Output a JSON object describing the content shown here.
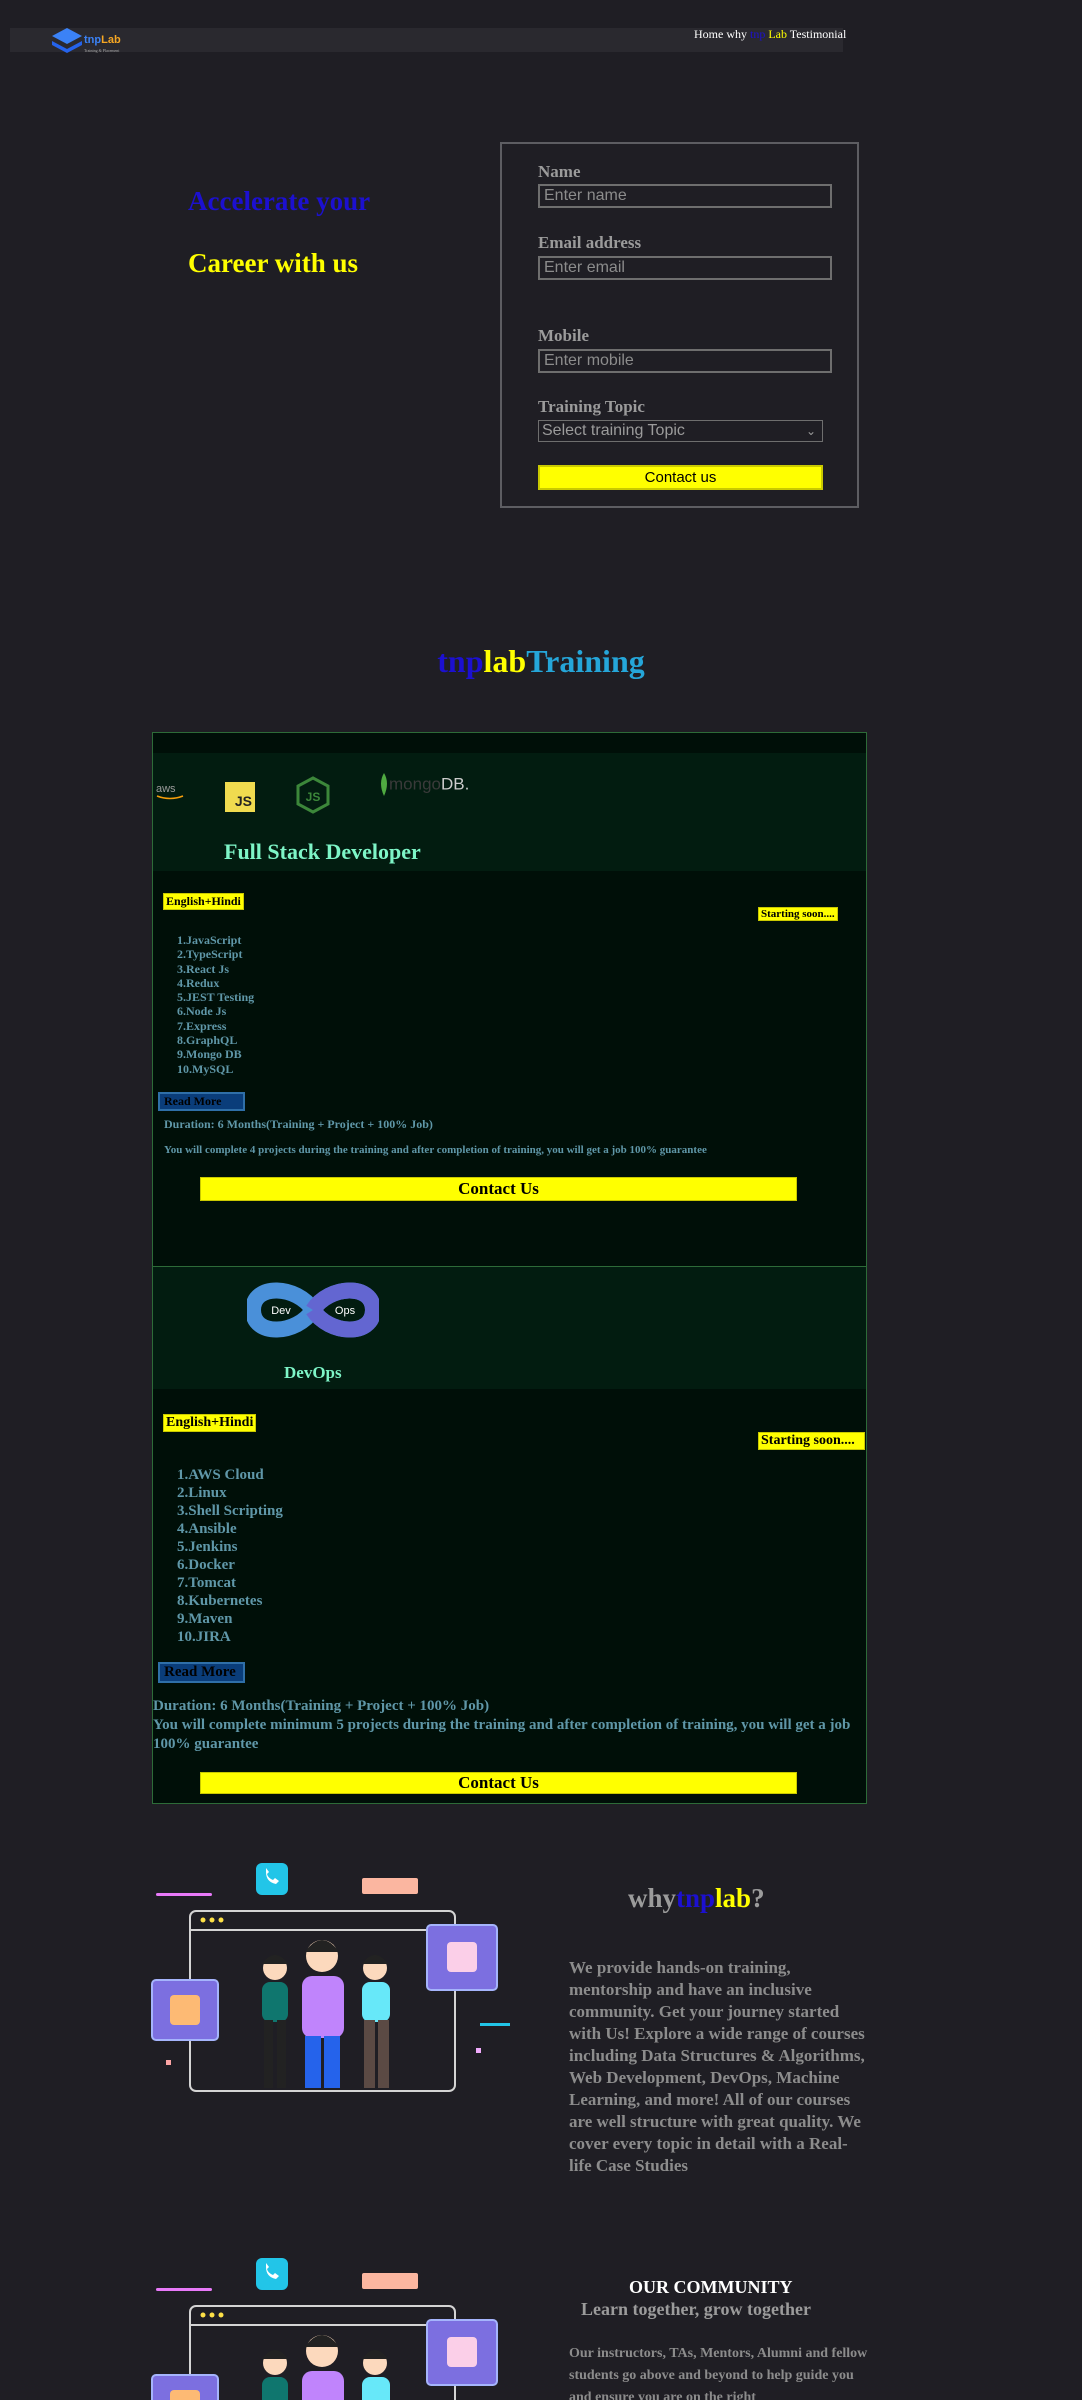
{
  "nav": {
    "logo_prefix": "tnp",
    "logo_suffix": "Lab",
    "logo_tagline": "Training & Placement",
    "home": "Home",
    "why": "why",
    "tnp": "tnp",
    "lab": "Lab",
    "testimonial": "Testimonial"
  },
  "hero": {
    "line1": "Accelerate your",
    "line2": "Career with us"
  },
  "form": {
    "name_label": "Name",
    "name_placeholder": "Enter name",
    "email_label": "Email address",
    "email_placeholder": "Enter email",
    "mobile_label": "Mobile",
    "mobile_placeholder": "Enter mobile",
    "topic_label": "Training Topic",
    "topic_selected": "Select training Topic",
    "submit": "Contact us"
  },
  "training_title": {
    "tnp": "tnp",
    "lab": "lab",
    "training": "Training"
  },
  "courses": [
    {
      "title": "Full Stack Developer",
      "language": "English+Hindi",
      "status": "Starting soon....",
      "topics": [
        "1.JavaScript",
        "2.TypeScript",
        "3.React Js",
        "4.Redux",
        "5.JEST Testing",
        "6.Node Js",
        "7.Express",
        "8.GraphQL",
        "9.Mongo DB",
        "10.MySQL"
      ],
      "read_more": "Read More",
      "duration": "Duration: 6 Months(Training + Project + 100% Job)",
      "description": "You will complete 4 projects during the training and after completion of training, you will get a job 100% guarantee",
      "cta": "Contact Us",
      "logos": {
        "aws": "aws",
        "js": "JS",
        "mongo_a": "mongo",
        "mongo_b": "DB."
      }
    },
    {
      "title": "DevOps",
      "language": "English+Hindi",
      "status": "Starting soon....",
      "topics": [
        "1.AWS Cloud",
        "2.Linux",
        "3.Shell Scripting",
        "4.Ansible",
        "5.Jenkins",
        "6.Docker",
        "7.Tomcat",
        "8.Kubernetes",
        "9.Maven",
        "10.JIRA"
      ],
      "read_more": "Read More",
      "duration": "Duration: 6 Months(Training + Project + 100% Job)",
      "description": "You will complete minimum 5 projects during the training and after completion of training, you will get a job 100% guarantee",
      "cta": "Contact Us",
      "logos": {
        "dev": "Dev",
        "ops": "Ops"
      }
    }
  ],
  "why": {
    "why": "why",
    "tnp": "tnp",
    "lab": "lab",
    "q": "?",
    "text": "We provide hands-on training, mentorship and have an inclusive community. Get your journey started with Us! Explore a wide range of courses including Data Structures & Algorithms, Web Development, DevOps, Machine Learning, and more! All of our courses are well structure with great quality. We cover every topic in detail with a Real-life Case Studies"
  },
  "community": {
    "title": "OUR COMMUNITY",
    "subtitle": "Learn together, grow together",
    "text": "Our instructors, TAs, Mentors, Alumni and fellow students go above and beyond to help guide you and ensure you are on the right"
  },
  "colors": {
    "background": "#1f1e24",
    "accent_yellow": "#ffff00",
    "accent_blue": "#1c10d0",
    "accent_cyan": "#25a6d9",
    "card_title": "#7ef5c7"
  }
}
